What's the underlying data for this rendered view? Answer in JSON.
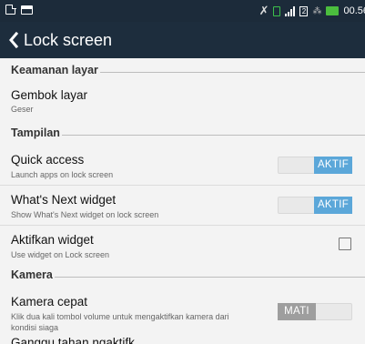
{
  "status_bar": {
    "time": "00.56",
    "left_icons": [
      "document-icon",
      "image-icon"
    ],
    "right_icons": [
      "mute-icon",
      "sim-icon",
      "signal-icon",
      "sim2-icon",
      "wifi-icon",
      "battery-icon"
    ],
    "sim2_label": "2"
  },
  "app_bar": {
    "title": "Lock screen",
    "back_icon": "chevron-left-icon"
  },
  "sections": {
    "security": {
      "title": "Keamanan layar"
    },
    "display": {
      "title": "Tampilan"
    },
    "camera": {
      "title": "Kamera"
    }
  },
  "items": {
    "screen_lock": {
      "title": "Gembok layar",
      "subtitle": "Geser"
    },
    "quick_access": {
      "title": "Quick access",
      "subtitle": "Launch apps on lock screen",
      "toggle_label": "AKTIF",
      "state": "on"
    },
    "whats_next": {
      "title": "What's Next widget",
      "subtitle": "Show What's Next widget on lock screen",
      "toggle_label": "AKTIF",
      "state": "on"
    },
    "enable_widget": {
      "title": "Aktifkan widget",
      "subtitle": "Use widget on Lock screen",
      "checked": false
    },
    "instant_camera": {
      "title": "Kamera cepat",
      "subtitle_line1": "Klik dua kali tombol volume untuk mengaktifkan kamera dari",
      "subtitle_line2": "kondisi siaga",
      "toggle_label": "MATI",
      "state": "off"
    },
    "partial_row": {
      "title": "Ganggu tahan ngaktifk..."
    }
  },
  "colors": {
    "status_bar_bg": "#1c2b3a",
    "app_bar_bg": "#1d2d3d",
    "toggle_on": "#5ba7d9",
    "toggle_off": "#9e9e9e",
    "page_bg": "#f3f3f3"
  }
}
